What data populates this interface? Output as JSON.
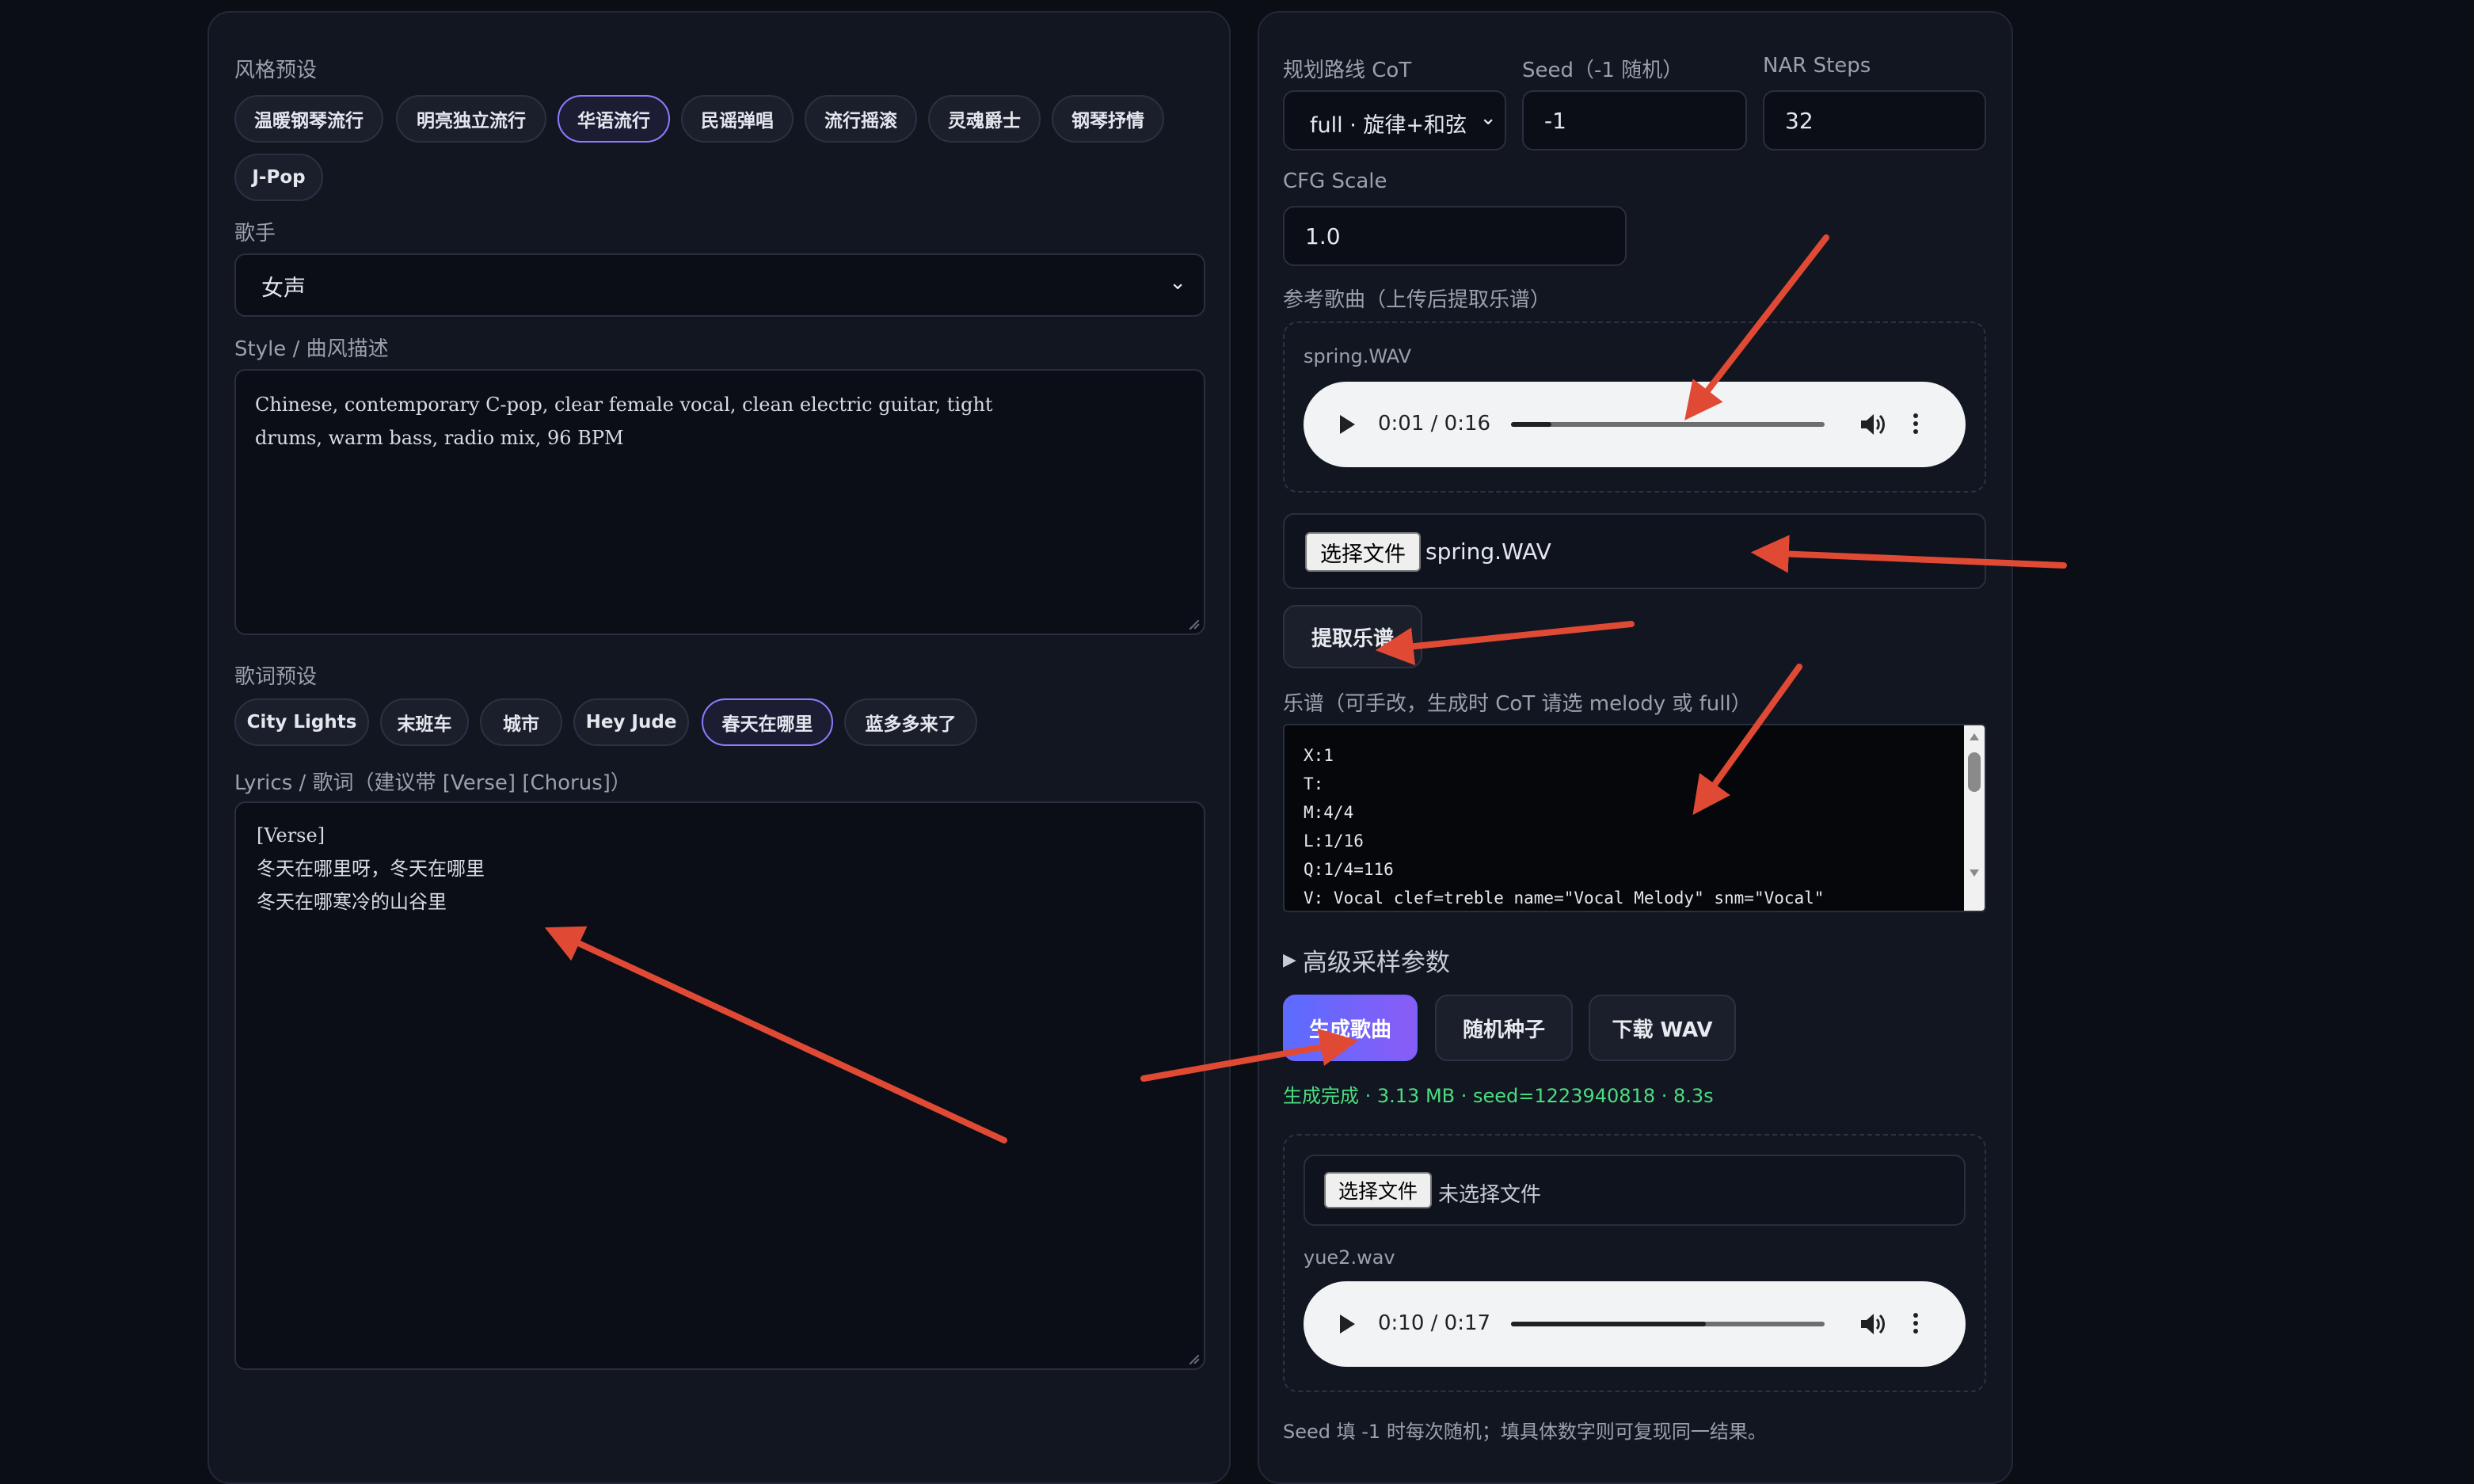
{
  "left": {
    "style_presets_label": "风格预设",
    "style_presets": [
      "温暖钢琴流行",
      "明亮独立流行",
      "华语流行",
      "民谣弹唱",
      "流行摇滚",
      "灵魂爵士",
      "钢琴抒情",
      "J-Pop"
    ],
    "style_presets_active": "华语流行",
    "singer_label": "歌手",
    "singer_value": "女声",
    "style_label": "Style / 曲风描述",
    "style_text": "Chinese, contemporary C-pop, clear female vocal, clean electric guitar, tight\ndrums, warm bass, radio mix, 96 BPM",
    "lyrics_presets_label": "歌词预设",
    "lyrics_presets": [
      "City Lights",
      "末班车",
      "城市",
      "Hey Jude",
      "春天在哪里",
      "蓝多多来了"
    ],
    "lyrics_presets_active": "春天在哪里",
    "lyrics_label": "Lyrics / 歌词（建议带 [Verse] [Chorus]）",
    "lyrics_text": "[Verse]\n冬天在哪里呀，冬天在哪里\n冬天在哪寒冷的山谷里"
  },
  "right": {
    "cot_label": "规划路线 CoT",
    "cot_value": "full · 旋律+和弦",
    "seed_label": "Seed（-1 随机）",
    "seed_value": "-1",
    "nar_label": "NAR Steps",
    "nar_value": "32",
    "cfg_label": "CFG Scale",
    "cfg_value": "1.0",
    "ref_label": "参考歌曲（上传后提取乐谱）",
    "ref_player": {
      "filename": "spring.WAV",
      "time": "0:01 / 0:16",
      "progress": 0.13
    },
    "file_button": "选择文件",
    "ref_file_name": "spring.WAV",
    "extract_button": "提取乐谱",
    "score_label": "乐谱（可手改，生成时 CoT 请选 melody 或 full）",
    "score_text": "X:1\nT:\nM:4/4\nL:1/16\nQ:1/4=116\nV: Vocal clef=treble name=\"Vocal Melody\" snm=\"Vocal\"",
    "advanced_label": "高级采样参数",
    "generate_button": "生成歌曲",
    "random_seed_button": "随机种子",
    "download_button": "下载 WAV",
    "status_text": "生成完成 · 3.13 MB · seed=1223940818 · 8.3s",
    "output_file_button": "选择文件",
    "output_file_none": "未选择文件",
    "output_player": {
      "filename": "yue2.wav",
      "time": "0:10 / 0:17",
      "progress": 0.62
    },
    "footer_note": "Seed 填 -1 时每次随机；填具体数字则可复现同一结果。"
  },
  "colors": {
    "accent": "#8b7dff",
    "status_green": "#4ade80",
    "annotation_arrow": "#e04a35"
  }
}
